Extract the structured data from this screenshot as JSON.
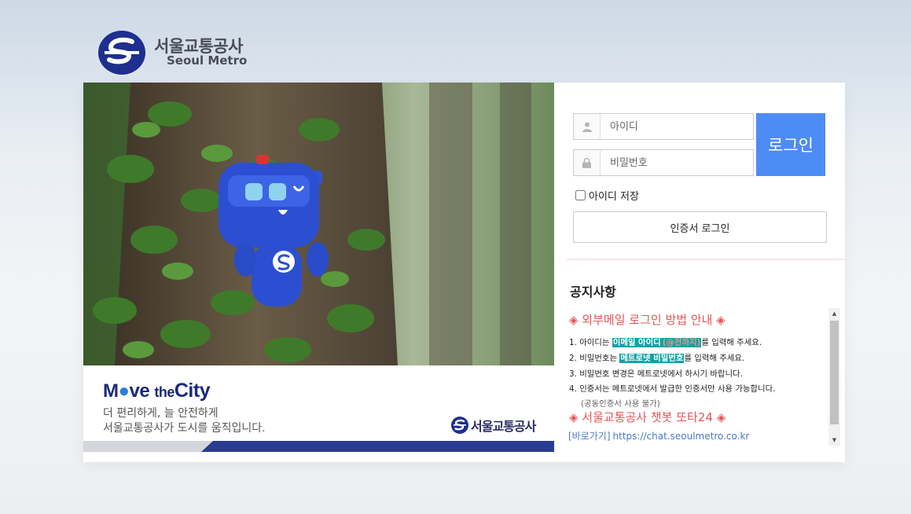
{
  "logo": {
    "korean": "서울교통공사",
    "english": "Seoul Metro"
  },
  "visual": {
    "slogan_move": "M",
    "slogan_ve": "ve",
    "slogan_the": "the",
    "slogan_city": "City",
    "subtitle_line1": "더 편리하게, 늘 안전하게",
    "subtitle_line2": "서울교통공사가 도시를 움직입니다.",
    "banner_logo": "서울교통공사"
  },
  "login": {
    "id_placeholder": "아이디",
    "pw_placeholder": "비밀번호",
    "login_button": "로그인",
    "save_id_label": "아이디 저장",
    "cert_login_button": "인증서 로그인"
  },
  "notice": {
    "title": "공지사항",
    "heading1": "◈ 외부메일 로그인 방법 안내 ◈",
    "line1_pre": "1. 아이디는 ",
    "line1_hl": "이메일 아이디",
    "line1_hl2": "(@전까지)",
    "line1_post": "를 입력해 주세요.",
    "line2_pre": "2. 비밀번호는 ",
    "line2_hl": "메트로넷 비밀번호",
    "line2_post": "를 입력해 주세요.",
    "line3": "3. 비밀번호 변경은 메트로넷에서 하시기 바랍니다.",
    "line4": "4. 인증서는 메트로넷에서 발급한 인증서만 사용 가능합니다.",
    "line5": "(공동인증서 사용 불가)",
    "heading2": "◈ 서울교통공사 챗봇 또타24 ◈",
    "link_label": "[바로가기]",
    "link_url": "https://chat.seoulmetro.co.kr"
  },
  "colors": {
    "brand_navy": "#1b2a7a",
    "login_blue": "#4d8cf5",
    "notice_red": "#e25656",
    "highlight_teal": "#0ea4a4"
  }
}
